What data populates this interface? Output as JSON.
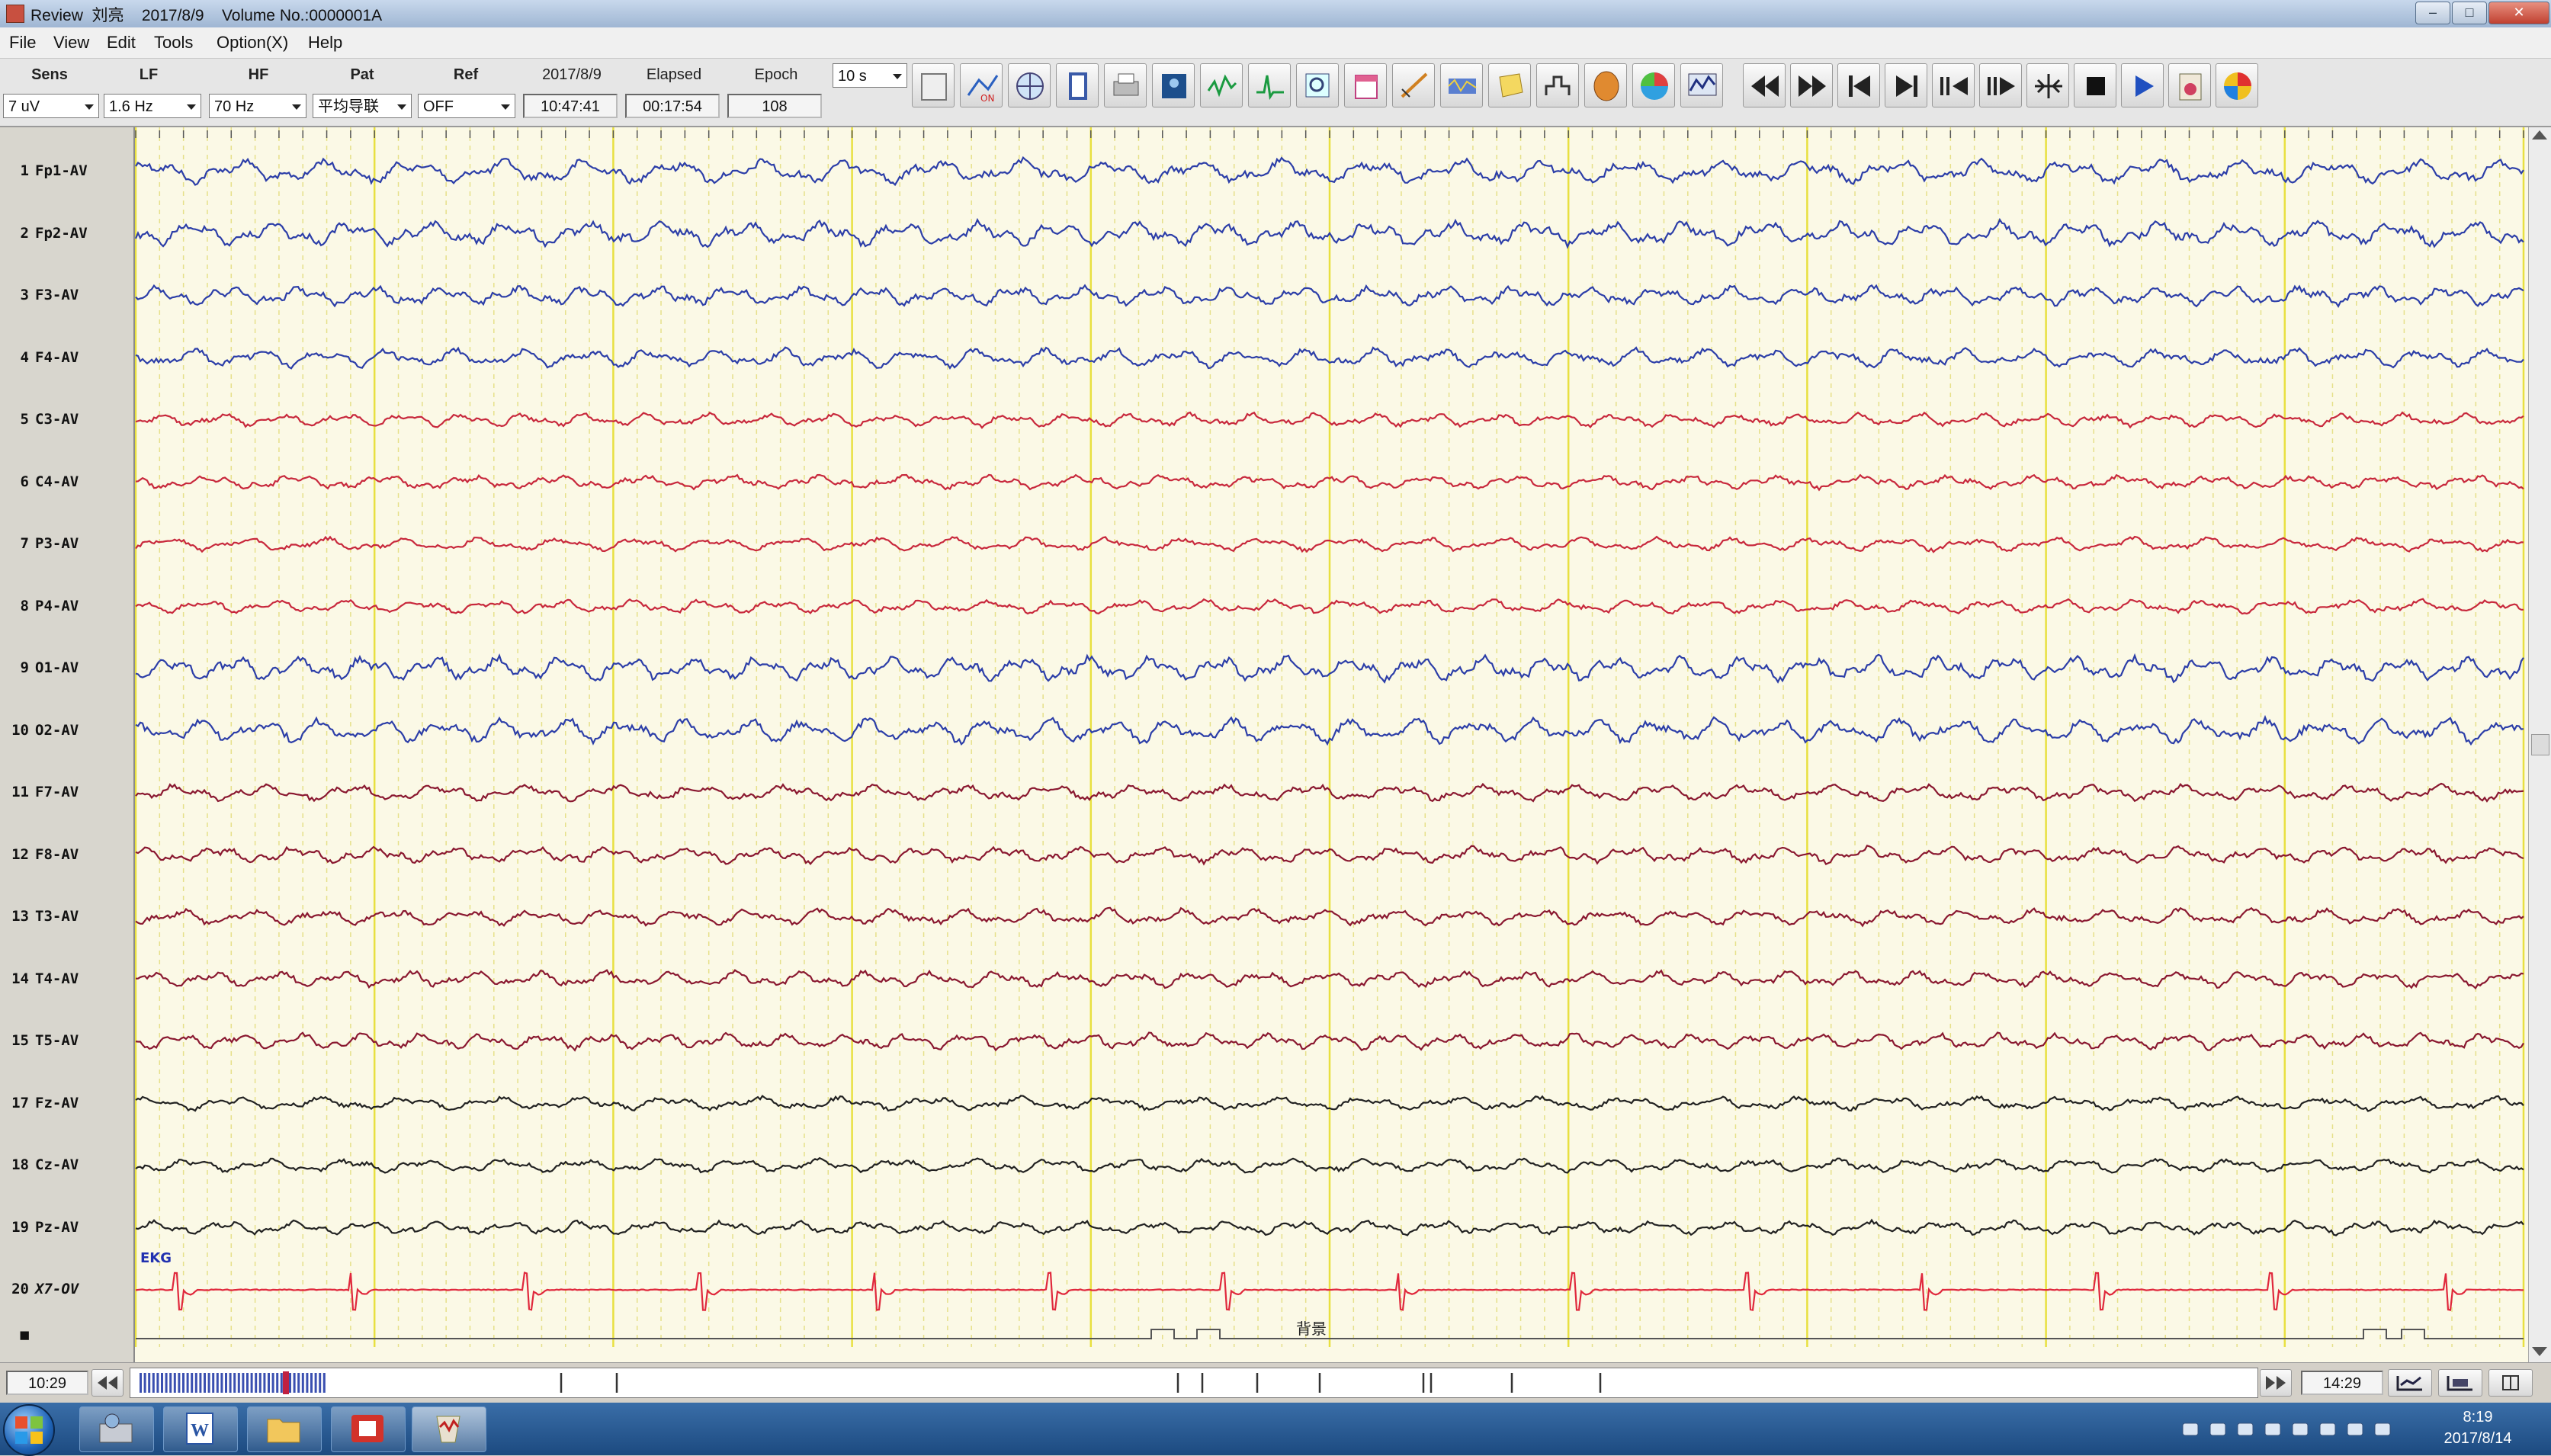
{
  "window": {
    "title": "Review  刘亮    2017/8/9    Volume No.:0000001A",
    "buttons": [
      "minimize",
      "maximize",
      "close"
    ]
  },
  "menu": {
    "items": [
      "File",
      "View",
      "Edit",
      "Tools",
      "Option(X)",
      "Help"
    ]
  },
  "params": {
    "sens": {
      "label": "Sens",
      "value": "7 uV"
    },
    "lf": {
      "label": "LF",
      "value": "1.6 Hz"
    },
    "hf": {
      "label": "HF",
      "value": "70 Hz"
    },
    "pat": {
      "label": "Pat",
      "value": "平均导联"
    },
    "ref": {
      "label": "Ref",
      "value": "OFF"
    },
    "date": {
      "label": "2017/8/9",
      "value": "10:47:41"
    },
    "elapsed": {
      "label": "Elapsed",
      "value": "00:17:54"
    },
    "epoch": {
      "label": "Epoch",
      "value": "108"
    },
    "timebase": "10 s"
  },
  "toolbar_icons": [
    "save-icon",
    "montage-on-icon",
    "globe-icon",
    "book-icon",
    "print-icon",
    "photo-icon",
    "waveform-icon",
    "spike-detect-icon",
    "zoom-wave-icon",
    "calendar-icon",
    "measure-icon",
    "spectrum-icon",
    "note-icon",
    "step-icon",
    "head-map-icon",
    "color-map-icon",
    "analysis-icon"
  ],
  "nav_icons": [
    "rewind-icon",
    "fast-forward-icon",
    "skip-start-icon",
    "skip-end-icon",
    "step-back-icon",
    "step-forward-icon",
    "split-icon",
    "stop-icon",
    "play-icon",
    "clipboard-icon",
    "topo-icon"
  ],
  "channels": [
    {
      "num": "1",
      "name": "Fp1-AV",
      "color": "#2c3ea8"
    },
    {
      "num": "2",
      "name": "Fp2-AV",
      "color": "#2c3ea8"
    },
    {
      "num": "3",
      "name": "F3-AV",
      "color": "#2c3ea8"
    },
    {
      "num": "4",
      "name": "F4-AV",
      "color": "#2c3ea8"
    },
    {
      "num": "5",
      "name": "C3-AV",
      "color": "#c8283c"
    },
    {
      "num": "6",
      "name": "C4-AV",
      "color": "#c8283c"
    },
    {
      "num": "7",
      "name": "P3-AV",
      "color": "#c8283c"
    },
    {
      "num": "8",
      "name": "P4-AV",
      "color": "#c8283c"
    },
    {
      "num": "9",
      "name": "O1-AV",
      "color": "#2c3ea8"
    },
    {
      "num": "10",
      "name": "O2-AV",
      "color": "#2c3ea8"
    },
    {
      "num": "11",
      "name": "F7-AV",
      "color": "#8a1830"
    },
    {
      "num": "12",
      "name": "F8-AV",
      "color": "#8a1830"
    },
    {
      "num": "13",
      "name": "T3-AV",
      "color": "#8a1830"
    },
    {
      "num": "14",
      "name": "T4-AV",
      "color": "#8a1830"
    },
    {
      "num": "15",
      "name": "T5-AV",
      "color": "#8a1830"
    },
    {
      "num": "17",
      "name": "Fz-AV",
      "color": "#222222"
    },
    {
      "num": "18",
      "name": "Cz-AV",
      "color": "#222222"
    },
    {
      "num": "19",
      "name": "Pz-AV",
      "color": "#222222"
    },
    {
      "num": "20",
      "name": "X7-OV",
      "color": "#e0283c"
    }
  ],
  "ekg_label": "EKG",
  "event_row_label": "■",
  "event_annotation": "背景",
  "nav": {
    "start_time": "10:29",
    "end_time": "14:29"
  },
  "taskbar": {
    "time": "8:19",
    "date": "2017/8/14"
  }
}
